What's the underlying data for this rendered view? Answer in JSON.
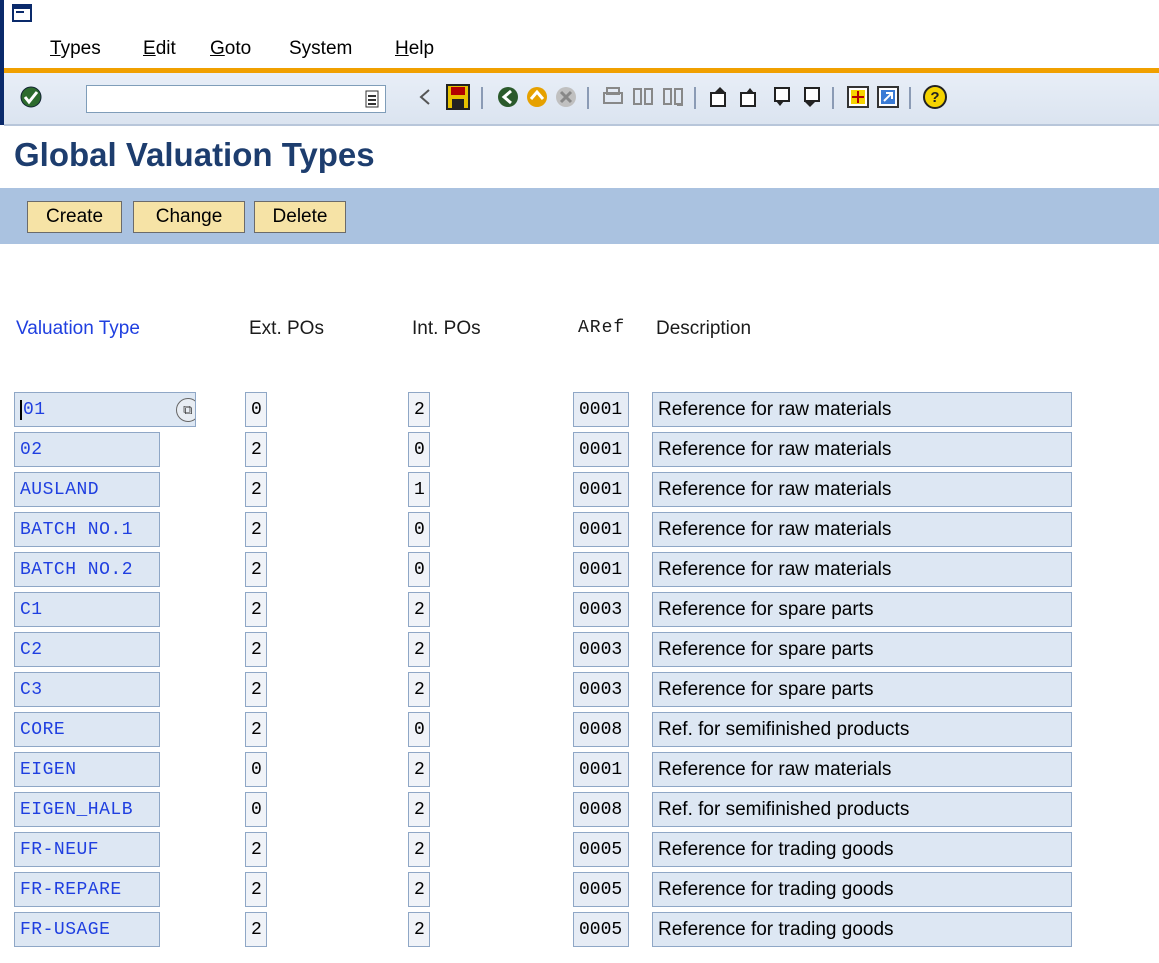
{
  "menu": {
    "items": [
      {
        "label": "Types",
        "ul": "T",
        "rest": "ypes"
      },
      {
        "label": "Edit",
        "ul": "E",
        "rest": "dit"
      },
      {
        "label": "Goto",
        "ul": "G",
        "rest": "oto"
      },
      {
        "label": "System",
        "ul": "",
        "rest": "System"
      },
      {
        "label": "Help",
        "ul": "H",
        "rest": "elp"
      }
    ]
  },
  "toolbar": {
    "command_field_value": "",
    "icons": [
      "enter-icon",
      "command-field",
      "back-arrow-icon",
      "save-icon",
      "back-icon",
      "exit-icon",
      "cancel-icon",
      "print-icon",
      "find-icon",
      "find-next-icon",
      "first-page-icon",
      "previous-page-icon",
      "next-page-icon",
      "last-page-icon",
      "create-session-icon",
      "shortcut-icon",
      "help-icon"
    ]
  },
  "page": {
    "title": "Global Valuation Types"
  },
  "app_toolbar": {
    "create_label": "Create",
    "change_label": "Change",
    "delete_label": "Delete"
  },
  "table": {
    "headers": {
      "valuation_type": "Valuation Type",
      "ext_pos": "Ext. POs",
      "int_pos": "Int. POs",
      "aref": "ARef",
      "description": "Description"
    },
    "rows": [
      {
        "type": "01",
        "ext": "0",
        "int": "2",
        "aref": "0001",
        "desc": "Reference for raw materials"
      },
      {
        "type": "02",
        "ext": "2",
        "int": "0",
        "aref": "0001",
        "desc": "Reference for raw materials"
      },
      {
        "type": "AUSLAND",
        "ext": "2",
        "int": "1",
        "aref": "0001",
        "desc": "Reference for raw materials"
      },
      {
        "type": "BATCH NO.1",
        "ext": "2",
        "int": "0",
        "aref": "0001",
        "desc": "Reference for raw materials"
      },
      {
        "type": "BATCH NO.2",
        "ext": "2",
        "int": "0",
        "aref": "0001",
        "desc": "Reference for raw materials"
      },
      {
        "type": "C1",
        "ext": "2",
        "int": "2",
        "aref": "0003",
        "desc": "Reference for spare parts"
      },
      {
        "type": "C2",
        "ext": "2",
        "int": "2",
        "aref": "0003",
        "desc": "Reference for spare parts"
      },
      {
        "type": "C3",
        "ext": "2",
        "int": "2",
        "aref": "0003",
        "desc": "Reference for spare parts"
      },
      {
        "type": "CORE",
        "ext": "2",
        "int": "0",
        "aref": "0008",
        "desc": "Ref. for semifinished products"
      },
      {
        "type": "EIGEN",
        "ext": "0",
        "int": "2",
        "aref": "0001",
        "desc": "Reference for raw materials"
      },
      {
        "type": "EIGEN_HALB",
        "ext": "0",
        "int": "2",
        "aref": "0008",
        "desc": "Ref. for semifinished products"
      },
      {
        "type": "FR-NEUF",
        "ext": "2",
        "int": "2",
        "aref": "0005",
        "desc": "Reference for trading goods"
      },
      {
        "type": "FR-REPARE",
        "ext": "2",
        "int": "2",
        "aref": "0005",
        "desc": "Reference for trading goods"
      },
      {
        "type": "FR-USAGE",
        "ext": "2",
        "int": "2",
        "aref": "0005",
        "desc": "Reference for trading goods"
      }
    ]
  }
}
